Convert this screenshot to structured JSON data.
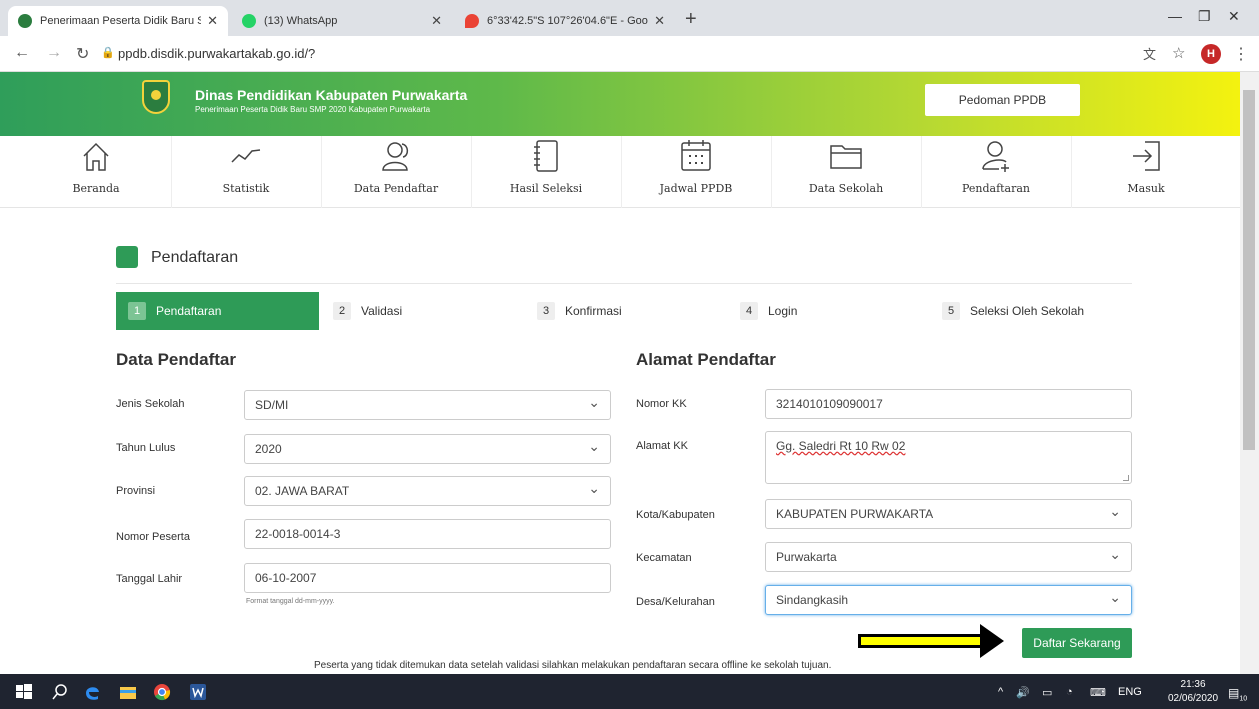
{
  "browser": {
    "tabs": [
      {
        "label": "Penerimaan Peserta Didik Baru S",
        "active": true
      },
      {
        "label": "(13) WhatsApp",
        "active": false
      },
      {
        "label": "6°33'42.5\"S 107°26'04.6\"E - Goog",
        "active": false
      }
    ],
    "url": "ppdb.disdik.purwakartakab.go.id/?",
    "profile_initial": "H"
  },
  "header": {
    "title": "Dinas Pendidikan Kabupaten Purwakarta",
    "subtitle": "Penerimaan Peserta Didik Baru SMP 2020 Kabupaten Purwakarta",
    "guide_button": "Pedoman PPDB"
  },
  "nav": [
    {
      "label": "Beranda",
      "icon": "home-icon"
    },
    {
      "label": "Statistik",
      "icon": "chart-line-icon"
    },
    {
      "label": "Data Pendaftar",
      "icon": "users-icon"
    },
    {
      "label": "Hasil Seleksi",
      "icon": "notebook-icon"
    },
    {
      "label": "Jadwal PPDB",
      "icon": "calendar-icon"
    },
    {
      "label": "Data Sekolah",
      "icon": "folder-icon"
    },
    {
      "label": "Pendaftaran",
      "icon": "user-add-icon"
    },
    {
      "label": "Masuk",
      "icon": "login-icon"
    }
  ],
  "section_title": "Pendaftaran",
  "steps": [
    {
      "num": "1",
      "label": "Pendaftaran"
    },
    {
      "num": "2",
      "label": "Validasi"
    },
    {
      "num": "3",
      "label": "Konfirmasi"
    },
    {
      "num": "4",
      "label": "Login"
    },
    {
      "num": "5",
      "label": "Seleksi Oleh Sekolah"
    }
  ],
  "left": {
    "title": "Data Pendaftar",
    "jenis_label": "Jenis Sekolah",
    "jenis_value": "SD/MI",
    "tahun_label": "Tahun Lulus",
    "tahun_value": "2020",
    "provinsi_label": "Provinsi",
    "provinsi_value": "02. JAWA BARAT",
    "nomor_label": "Nomor Peserta",
    "nomor_value": "22-0018-0014-3",
    "tgl_label": "Tanggal Lahir",
    "tgl_value": "06-10-2007",
    "tgl_hint": "Format tanggal dd-mm-yyyy."
  },
  "right": {
    "title": "Alamat Pendaftar",
    "kk_label": "Nomor KK",
    "kk_value": "3214010109090017",
    "alamat_label": "Alamat KK",
    "alamat_value": "Gg. Saledri Rt 10 Rw 02",
    "kota_label": "Kota/Kabupaten",
    "kota_value": "KABUPATEN PURWAKARTA",
    "kec_label": "Kecamatan",
    "kec_value": "Purwakarta",
    "desa_label": "Desa/Kelurahan",
    "desa_value": "Sindangkasih"
  },
  "submit_label": "Daftar Sekarang",
  "footnote": "Peserta yang tidak ditemukan data setelah validasi silahkan melakukan pendaftaran secara offline ke sekolah tujuan.",
  "taskbar": {
    "lang": "ENG",
    "time": "21:36",
    "date": "02/06/2020",
    "notif_count": "10"
  }
}
